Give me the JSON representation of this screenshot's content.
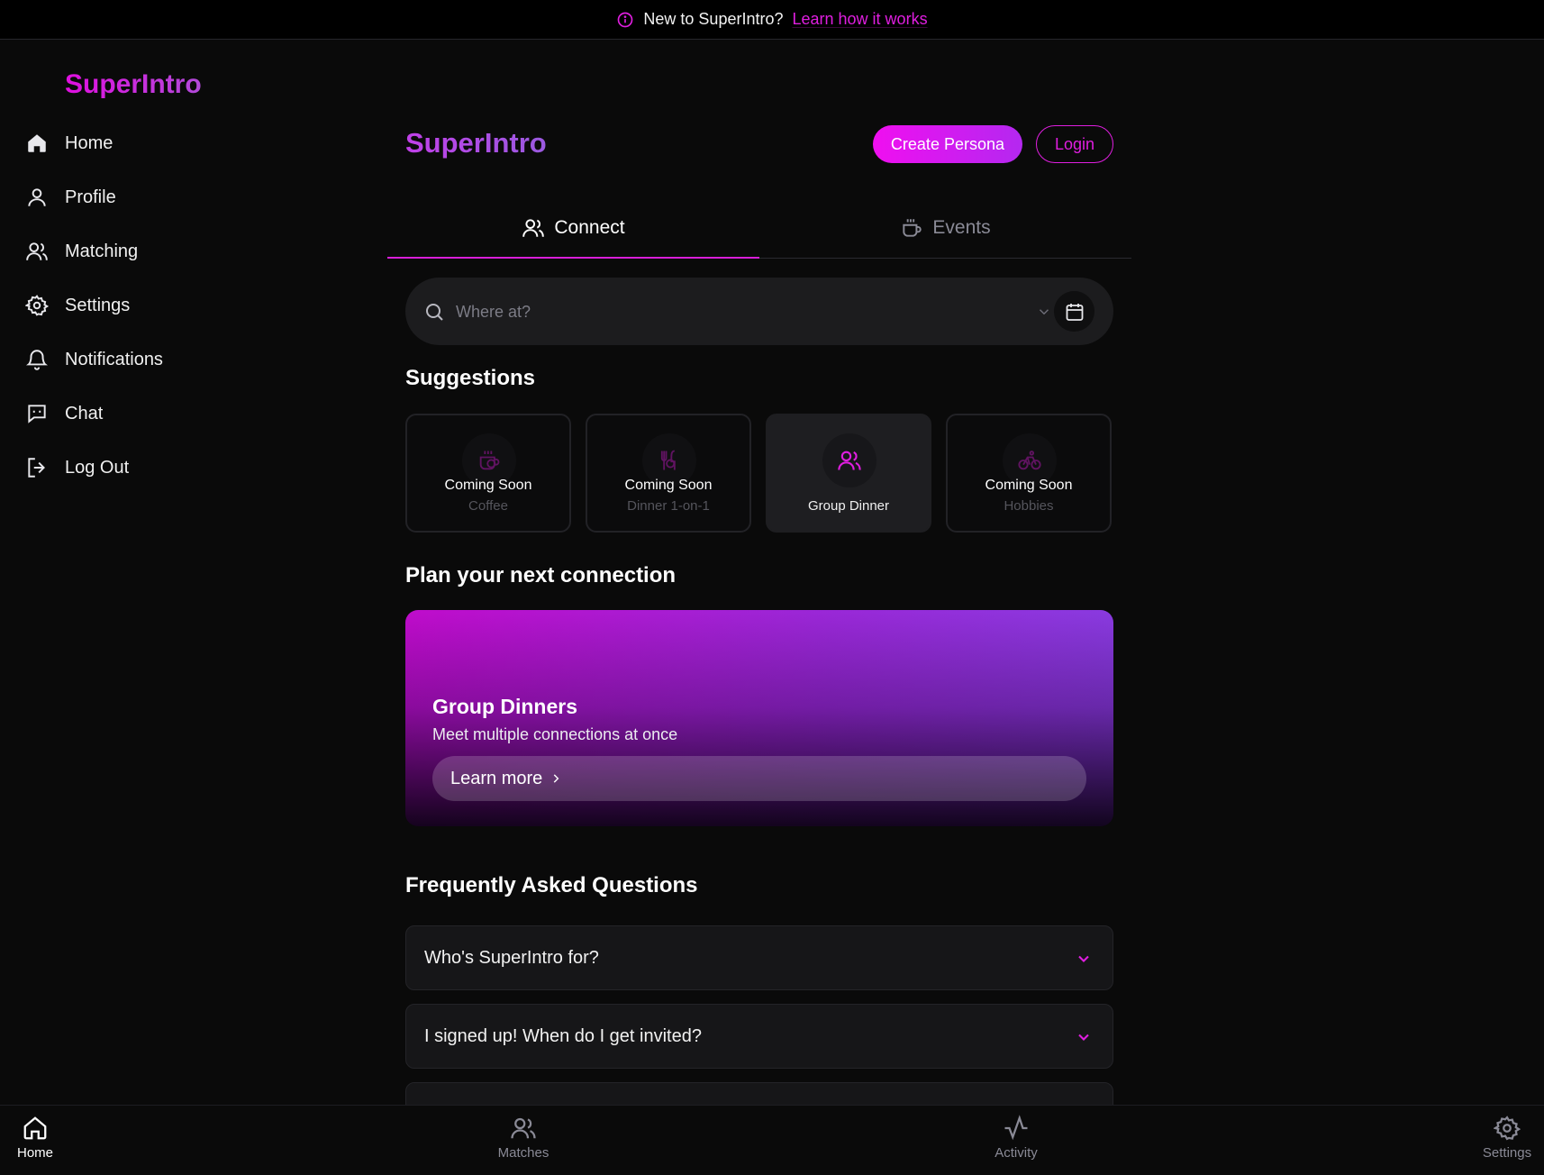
{
  "banner": {
    "text": "New to SuperIntro?",
    "link": "Learn how it works"
  },
  "sidebar": {
    "brand": "SuperIntro",
    "items": [
      {
        "label": "Home",
        "icon": "home-icon"
      },
      {
        "label": "Profile",
        "icon": "user-icon"
      },
      {
        "label": "Matching",
        "icon": "users-icon"
      },
      {
        "label": "Settings",
        "icon": "gear-icon"
      },
      {
        "label": "Notifications",
        "icon": "bell-icon"
      },
      {
        "label": "Chat",
        "icon": "chat-icon"
      },
      {
        "label": "Log Out",
        "icon": "logout-icon"
      }
    ]
  },
  "header": {
    "title": "SuperIntro",
    "create_label": "Create Persona",
    "login_label": "Login"
  },
  "tabs": [
    {
      "label": "Connect",
      "active": true
    },
    {
      "label": "Events",
      "active": false
    }
  ],
  "search": {
    "placeholder": "Where at?"
  },
  "suggestions": {
    "heading": "Suggestions",
    "cards": [
      {
        "status": "Coming Soon",
        "label": "Coffee",
        "icon": "coffee-icon",
        "enabled": false
      },
      {
        "status": "Coming Soon",
        "label": "Dinner 1-on-1",
        "icon": "utensils-icon",
        "enabled": false
      },
      {
        "status": "",
        "label": "Group Dinner",
        "icon": "users-icon",
        "enabled": true
      },
      {
        "status": "Coming Soon",
        "label": "Hobbies",
        "icon": "bike-icon",
        "enabled": false
      }
    ]
  },
  "plan": {
    "heading": "Plan your next connection",
    "promo_title": "Group Dinners",
    "promo_subtitle": "Meet multiple connections at once",
    "promo_button": "Learn more"
  },
  "faq": {
    "heading": "Frequently Asked Questions",
    "items": [
      {
        "question": "Who's SuperIntro for?"
      },
      {
        "question": "I signed up! When do I get invited?"
      }
    ]
  },
  "bottom_nav": [
    {
      "label": "Home",
      "active": true
    },
    {
      "label": "Matches",
      "active": false
    },
    {
      "label": "Activity",
      "active": false
    },
    {
      "label": "Settings",
      "active": false
    }
  ],
  "colors": {
    "accent": "#e01ee0",
    "background": "#0a0a0a",
    "card": "#1e1e21"
  }
}
